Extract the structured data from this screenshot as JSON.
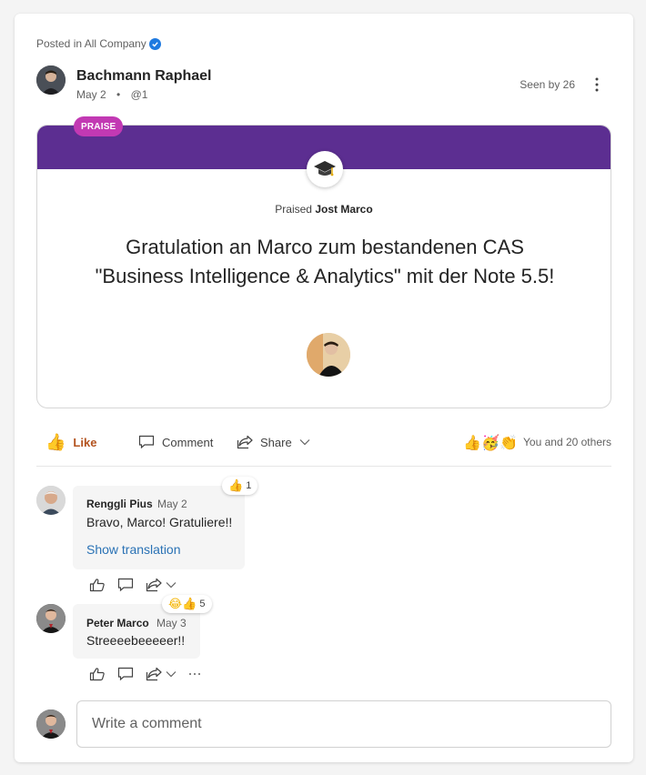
{
  "post": {
    "posted_in": "Posted in All Company",
    "author": "Bachmann Raphael",
    "date": "May 2",
    "mention": "@1",
    "seen_by": "Seen by 26"
  },
  "praise": {
    "badge": "PRAISE",
    "praised_prefix": "Praised",
    "praised_name": "Jost Marco",
    "message": "Gratulation an Marco zum bestandenen CAS \"Business Intelligence & Analytics\" mit der Note 5.5!",
    "colors": {
      "banner": "#5c2e91",
      "badge": "#c239b3"
    }
  },
  "actions": {
    "like": "Like",
    "comment": "Comment",
    "share": "Share",
    "reactions_text": "You and 20 others"
  },
  "comments": [
    {
      "author": "Renggli Pius",
      "date": "May 2",
      "text": "Bravo, Marco! Gratuliere!!",
      "translation_link": "Show translation",
      "reaction_count": "1"
    },
    {
      "author": "Peter Marco",
      "date": "May 3",
      "text": "Streeeebeeeeer!!",
      "reaction_count": "5"
    }
  ],
  "composer": {
    "placeholder": "Write a comment"
  },
  "icons": [
    "verified-icon",
    "more-icon",
    "graduation-cap-icon",
    "thumbs-up-icon",
    "comment-icon",
    "share-icon",
    "chevron-down-icon",
    "ellipsis-icon"
  ],
  "accent": "#b3531f"
}
